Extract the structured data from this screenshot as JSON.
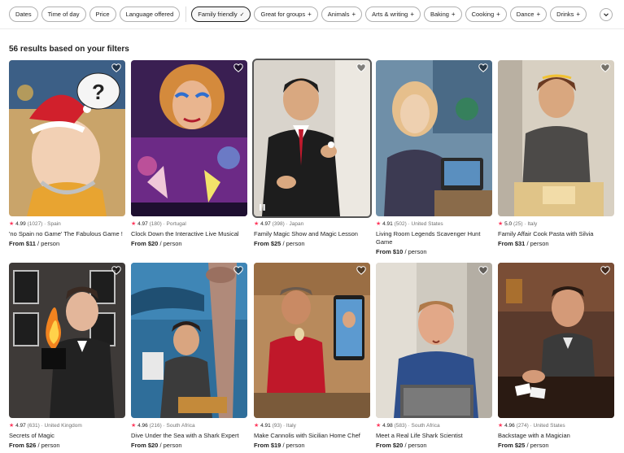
{
  "filters": {
    "chips": [
      {
        "label": "Dates",
        "plus": false
      },
      {
        "label": "Time of day",
        "plus": false
      },
      {
        "label": "Price",
        "plus": false
      },
      {
        "label": "Language offered",
        "plus": false
      }
    ],
    "selected_chip": {
      "label": "Family friendly",
      "check": "✓"
    },
    "category_chips": [
      {
        "label": "Great for groups",
        "plus": "+"
      },
      {
        "label": "Animals",
        "plus": "+"
      },
      {
        "label": "Arts & writing",
        "plus": "+"
      },
      {
        "label": "Baking",
        "plus": "+"
      },
      {
        "label": "Cooking",
        "plus": "+"
      },
      {
        "label": "Dance",
        "plus": "+"
      },
      {
        "label": "Drinks",
        "plus": "+"
      }
    ],
    "more_icon": "chevron-down-icon"
  },
  "results_heading": "56 results based on your filters",
  "accent_color": "#ff385c",
  "listings": [
    {
      "rating": "4.99",
      "reviews": "(1027)",
      "country": "Spain",
      "title": "'no Spain no Game' The Fabulous Game !",
      "price_from": "From $11",
      "price_unit": "/ person"
    },
    {
      "rating": "4.97",
      "reviews": "(180)",
      "country": "Portugal",
      "title": "Clock Down the Interactive Live Musical",
      "price_from": "From $20",
      "price_unit": "/ person"
    },
    {
      "rating": "4.97",
      "reviews": "(398)",
      "country": "Japan",
      "title": "Family Magic Show and Magic Lesson",
      "price_from": "From $25",
      "price_unit": "/ person"
    },
    {
      "rating": "4.91",
      "reviews": "(502)",
      "country": "United States",
      "title": "Living Room Legends Scavenger Hunt Game",
      "price_from": "From $10",
      "price_unit": "/ person"
    },
    {
      "rating": "5.0",
      "reviews": "(25)",
      "country": "Italy",
      "title": "Family Affair Cook Pasta with Silvia",
      "price_from": "From $31",
      "price_unit": "/ person"
    },
    {
      "rating": "4.97",
      "reviews": "(631)",
      "country": "United Kingdom",
      "title": "Secrets of Magic",
      "price_from": "From $26",
      "price_unit": "/ person"
    },
    {
      "rating": "4.96",
      "reviews": "(216)",
      "country": "South Africa",
      "title": "Dive Under the Sea with a Shark Expert",
      "price_from": "From $20",
      "price_unit": "/ person"
    },
    {
      "rating": "4.91",
      "reviews": "(93)",
      "country": "Italy",
      "title": "Make Cannolis with Sicilian Home Chef",
      "price_from": "From $19",
      "price_unit": "/ person"
    },
    {
      "rating": "4.98",
      "reviews": "(583)",
      "country": "South Africa",
      "title": "Meet a Real Life Shark Scientist",
      "price_from": "From $20",
      "price_unit": "/ person"
    },
    {
      "rating": "4.96",
      "reviews": "(274)",
      "country": "United States",
      "title": "Backstage with a Magician",
      "price_from": "From $25",
      "price_unit": "/ person"
    }
  ],
  "sep": "·",
  "star": "★"
}
